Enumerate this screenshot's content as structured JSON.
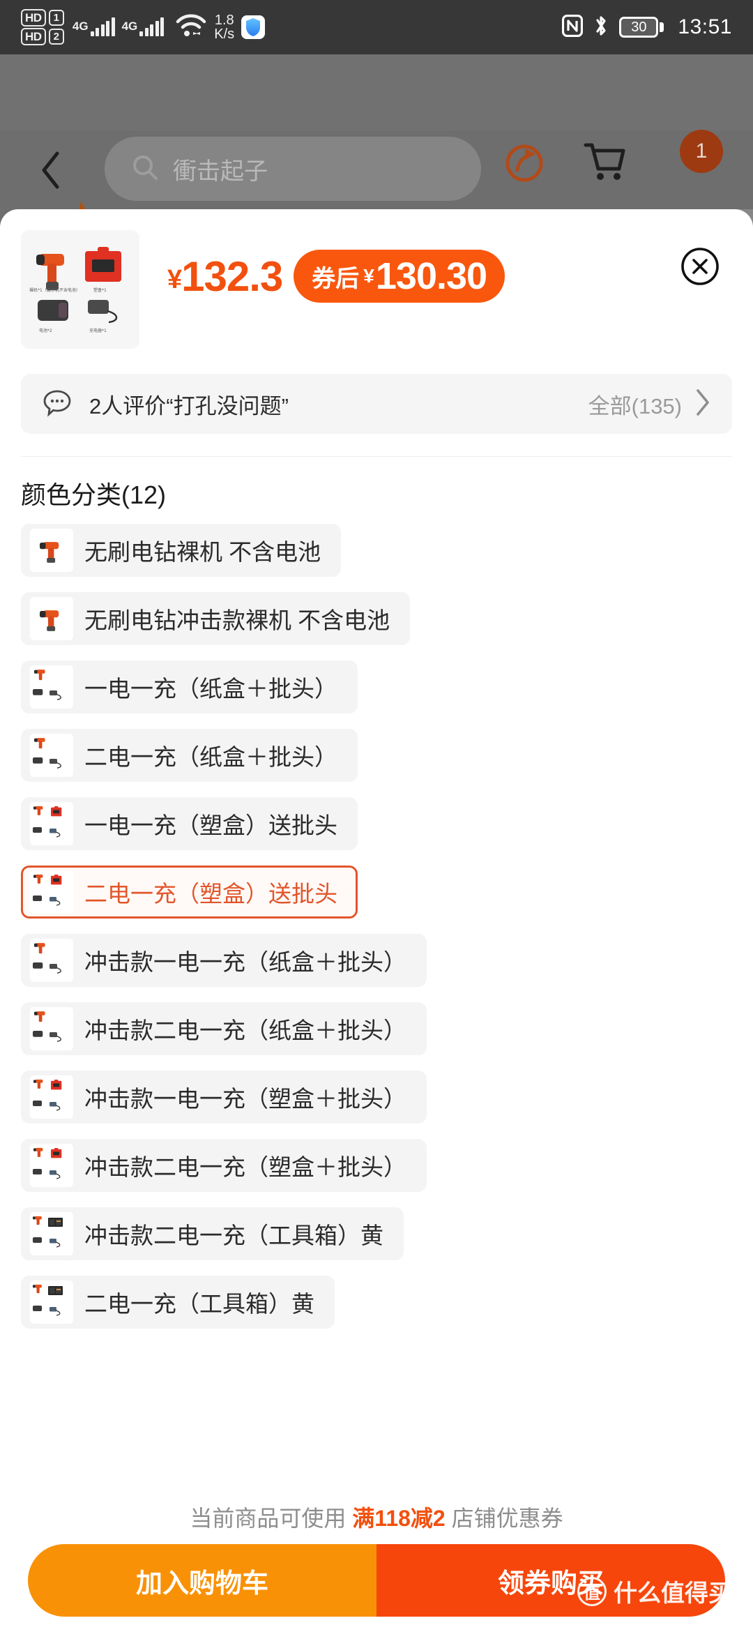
{
  "status_bar": {
    "hd1_label": "HD",
    "sim1": "1",
    "hd2_label": "HD",
    "sim2": "2",
    "network1": "4G",
    "network2": "4G",
    "net_speed_value": "1.8",
    "net_speed_unit": "K/s",
    "shield_icon": "shield-icon",
    "nfc_icon": "nfc-icon",
    "bluetooth_icon": "bluetooth-icon",
    "battery_level": "30",
    "time": "13:51"
  },
  "backdrop_navbar": {
    "back_icon": "back-chevron-icon",
    "search_value": "衝击起子",
    "search_icon": "search-icon",
    "share_icon": "share-icon",
    "cart_icon": "cart-icon",
    "avatar_badge": "1",
    "flame_icon": "flame-icon"
  },
  "sheet": {
    "price": {
      "currency": "¥",
      "amount": "132.3",
      "coupon_label": "券后",
      "coupon_currency": "¥",
      "coupon_amount": "130.30"
    },
    "close_icon": "close-circle-icon",
    "thumbnail_alt": "product-thumbnail"
  },
  "review": {
    "bubble_icon": "comment-bubble-icon",
    "text": "2人评价“打孔没问题”",
    "all_label": "全部(135)",
    "chevron_icon": "chevron-right-icon"
  },
  "color_section": {
    "title": "颜色分类(12)",
    "options": [
      {
        "label": "无刷电钻裸机 不含电池",
        "selected": false,
        "art": "drill"
      },
      {
        "label": "无刷电钻冲击款裸机 不含电池",
        "selected": false,
        "art": "drill"
      },
      {
        "label": "一电一充（纸盒＋批头）",
        "selected": false,
        "art": "kit-paper"
      },
      {
        "label": "二电一充（纸盒＋批头）",
        "selected": false,
        "art": "kit-paper"
      },
      {
        "label": "一电一充（塑盒）送批头",
        "selected": false,
        "art": "kit-case"
      },
      {
        "label": "二电一充（塑盒）送批头",
        "selected": true,
        "art": "kit-case"
      },
      {
        "label": "冲击款一电一充（纸盒＋批头）",
        "selected": false,
        "art": "kit-paper"
      },
      {
        "label": "冲击款二电一充（纸盒＋批头）",
        "selected": false,
        "art": "kit-paper"
      },
      {
        "label": "冲击款一电一充（塑盒＋批头）",
        "selected": false,
        "art": "kit-case"
      },
      {
        "label": "冲击款二电一充（塑盒＋批头）",
        "selected": false,
        "art": "kit-case"
      },
      {
        "label": "冲击款二电一充（工具箱）黄",
        "selected": false,
        "art": "kit-box"
      },
      {
        "label": "二电一充（工具箱）黄",
        "selected": false,
        "art": "kit-box"
      }
    ]
  },
  "footer": {
    "coupon_note_prefix": "当前商品可使用 ",
    "coupon_note_highlight": "满118减2",
    "coupon_note_suffix": " 店铺优惠券",
    "add_to_cart_label": "加入购物车",
    "buy_with_coupon_label": "领券购买"
  },
  "watermark": {
    "mark": "值",
    "text": "什么值得买"
  },
  "colors": {
    "accent_orange": "#f2500e",
    "coupon_pill": "#f9570e",
    "selected_border": "#e2552a",
    "cart_button": "#f99106",
    "buy_button": "#f6460b",
    "status_bar_bg": "#373737",
    "backdrop": "#6e6e6e"
  }
}
